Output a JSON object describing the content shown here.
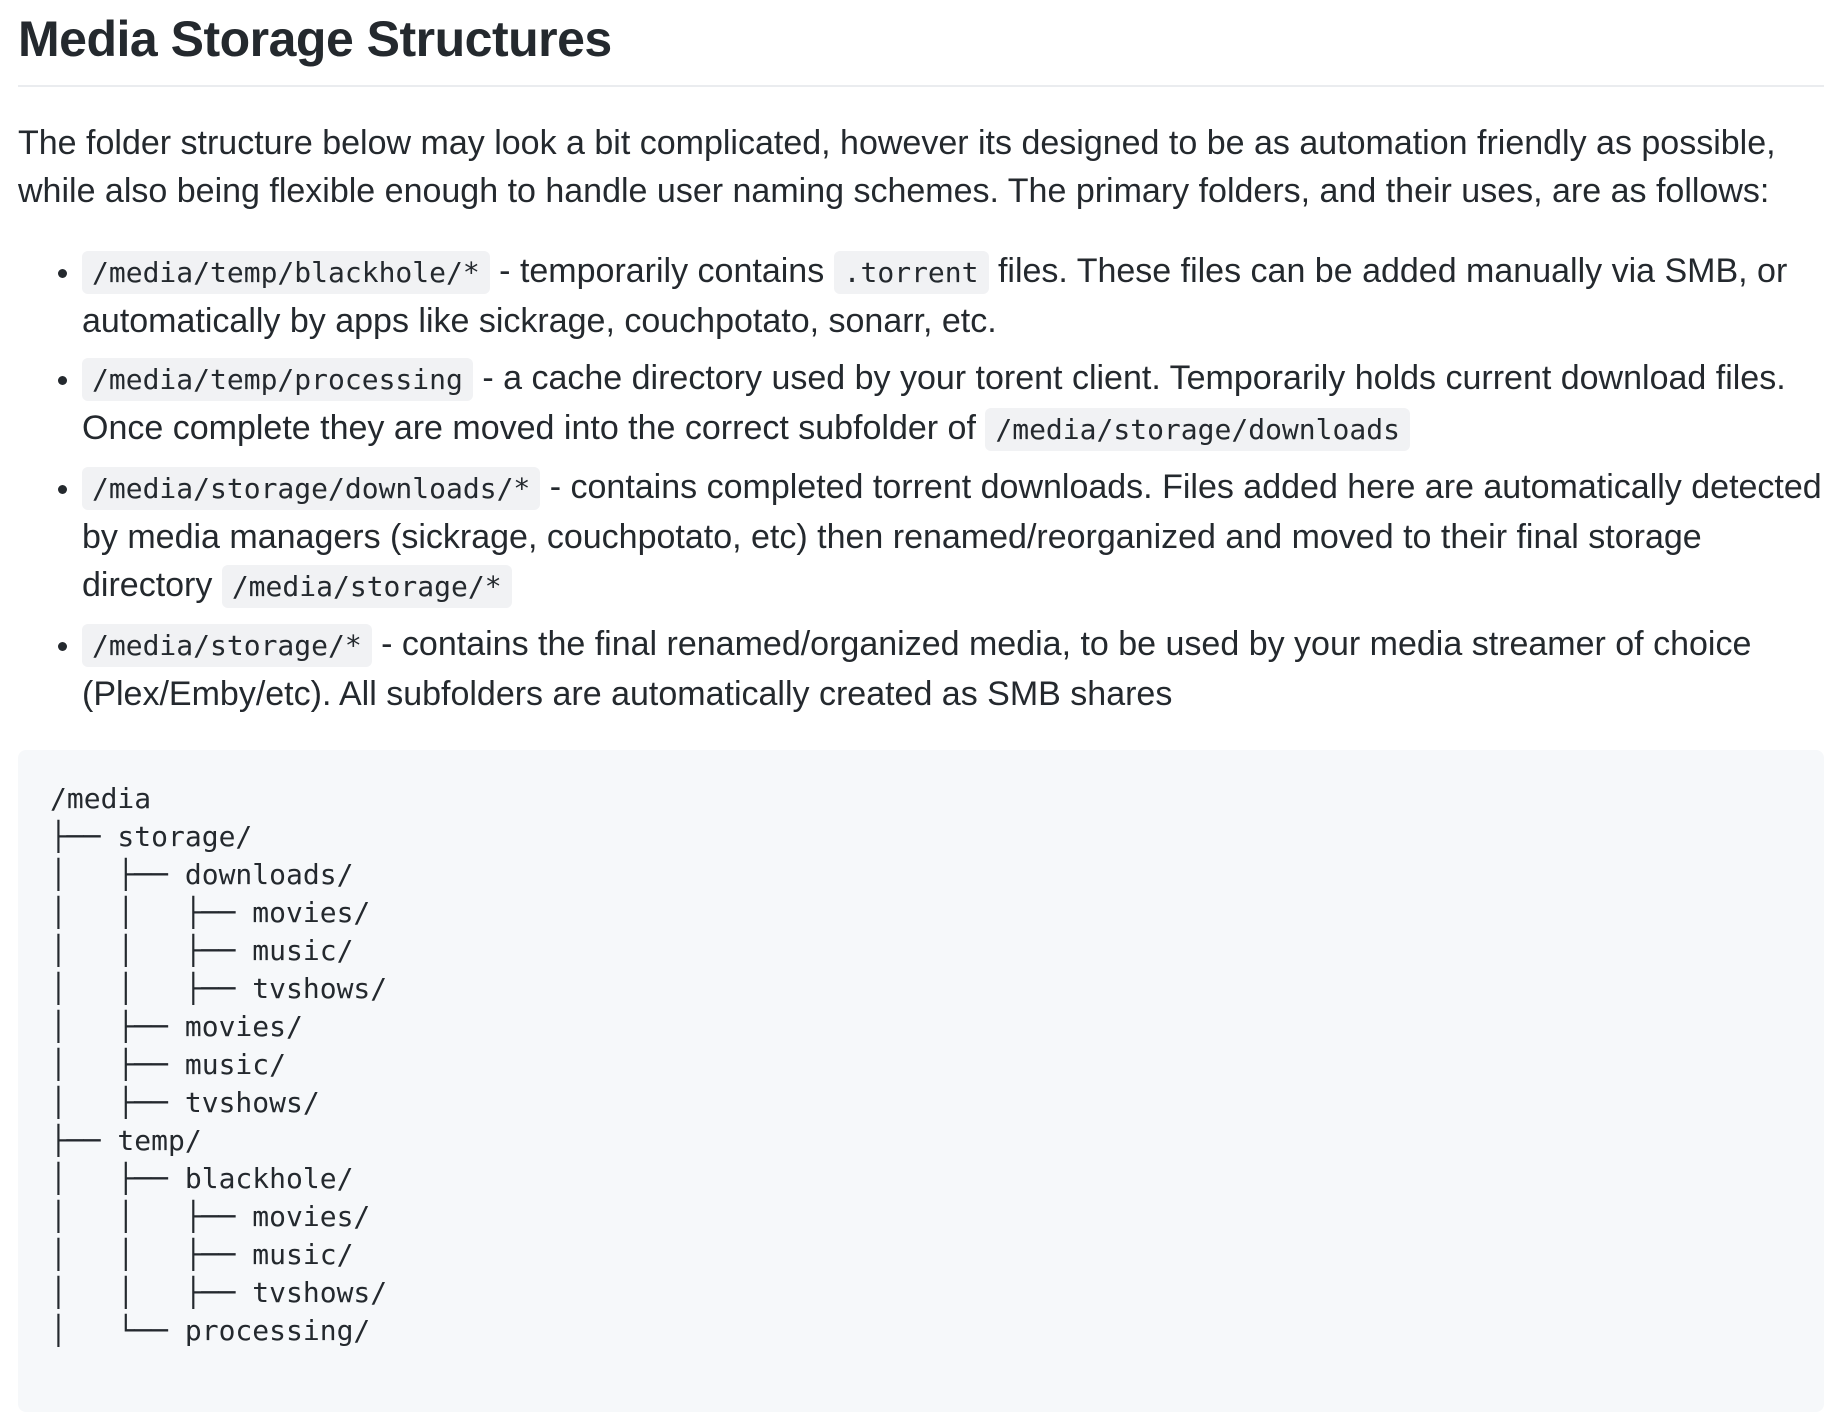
{
  "title": "Media Storage Structures",
  "intro": "The folder structure below may look a bit complicated, however its designed to be as automation friendly as possible, while also being flexible enough to handle user naming schemes. The primary folders, and their uses, are as follows:",
  "items": [
    {
      "code": "/media/temp/blackhole/*",
      "text1": " - temporarily contains ",
      "code2": ".torrent",
      "text2": " files. These files can be added manually via SMB, or automatically by apps like sickrage, couchpotato, sonarr, etc."
    },
    {
      "code": "/media/temp/processing",
      "text1": " - a cache directory used by your torent client. Temporarily holds current download files. Once complete they are moved into the correct subfolder of ",
      "code2": "/media/storage/downloads",
      "text2": ""
    },
    {
      "code": "/media/storage/downloads/*",
      "text1": " - contains completed torrent downloads. Files added here are automatically detected by media managers (sickrage, couchpotato, etc) then renamed/reorganized and moved to their final storage directory ",
      "code2": "/media/storage/*",
      "text2": ""
    },
    {
      "code": "/media/storage/*",
      "text1": " - contains the final renamed/organized media, to be used by your media streamer of choice (Plex/Emby/etc). All subfolders are automatically created as SMB shares",
      "code2": "",
      "text2": ""
    }
  ],
  "tree": [
    "/media",
    "├── storage/",
    "│   ├── downloads/",
    "│   │   ├── movies/",
    "│   │   ├── music/",
    "│   │   ├── tvshows/",
    "│   ├── movies/",
    "│   ├── music/",
    "│   ├── tvshows/",
    "├── temp/",
    "│   ├── blackhole/",
    "│   │   ├── movies/",
    "│   │   ├── music/",
    "│   │   ├── tvshows/",
    "│   └── processing/"
  ]
}
